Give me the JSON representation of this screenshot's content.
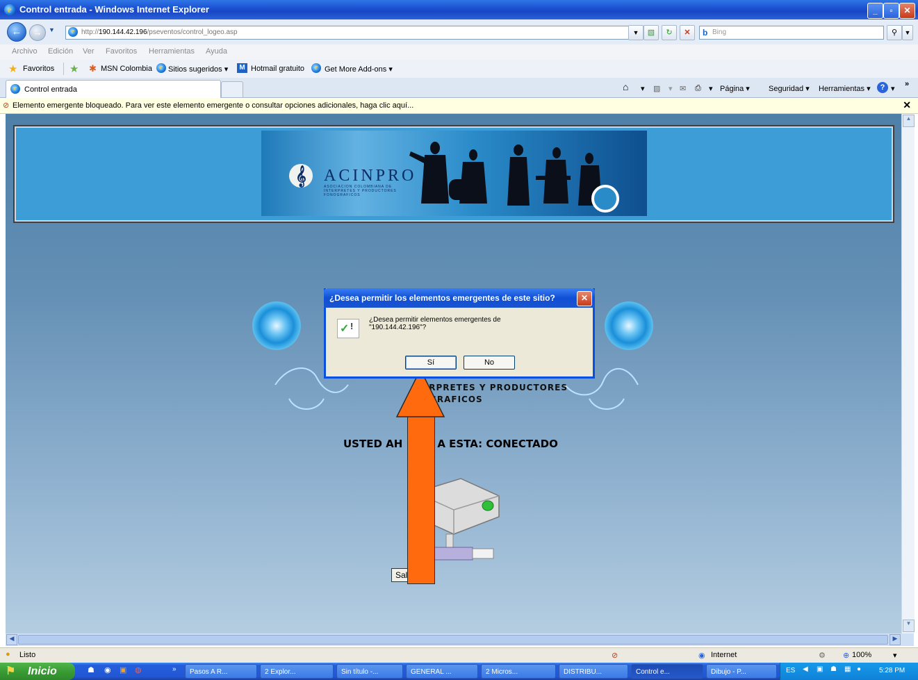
{
  "window": {
    "title": "Control entrada - Windows Internet Explorer"
  },
  "address": {
    "prefix": "http://",
    "host": "190.144.42.196",
    "path": "/pseventos/control_logeo.asp"
  },
  "search": {
    "placeholder": "Bing"
  },
  "menu": [
    "Archivo",
    "Edición",
    "Ver",
    "Favoritos",
    "Herramientas",
    "Ayuda"
  ],
  "favorites": {
    "label": "Favoritos",
    "items": [
      "MSN Colombia",
      "Sitios sugeridos ▾",
      "Hotmail gratuito",
      "Get More Add-ons ▾"
    ]
  },
  "tab": {
    "label": "Control entrada"
  },
  "commandbar": {
    "page": "Página ▾",
    "security": "Seguridad ▾",
    "tools": "Herramientas ▾"
  },
  "infobar": {
    "message": "Elemento emergente bloqueado. Para ver este elemento emergente o consultar opciones adicionales, haga clic aquí..."
  },
  "banner": {
    "logo": "ACINPRO",
    "subtitle": "ASOCIACION COLOMBIANA DE INTERPRETES Y PRODUCTORES FONOGRAFICOS"
  },
  "page": {
    "org_line1": "ERPRETES Y PRODUCTORES",
    "org_line2": "GRAFICOS",
    "status_left": "USTED AH",
    "status_right": "A ESTA: CONECTADO",
    "logout_button": "Salir"
  },
  "dialog": {
    "title": "¿Desea permitir los elementos emergentes de este sitio?",
    "message_line1": "¿Desea permitir elementos emergentes de",
    "message_line2": "\"190.144.42.196\"?",
    "yes": "Sí",
    "no": "No"
  },
  "statusbar": {
    "status": "Listo",
    "zone": "Internet",
    "zoom": "100%"
  },
  "taskbar": {
    "start": "Inicio",
    "tasks": [
      "Pasos A R...",
      "2 Explor...",
      "Sin título -...",
      "GENERAL ...",
      "2 Micros...",
      "DISTRIBU...",
      "Control e...",
      "Dibujo - P..."
    ],
    "lang": "ES",
    "clock": "5:28 PM"
  },
  "colors": {
    "arrow": "#ff6a0e",
    "titlebar": "#1a4fd0",
    "dialog_border": "#0a50e0"
  }
}
